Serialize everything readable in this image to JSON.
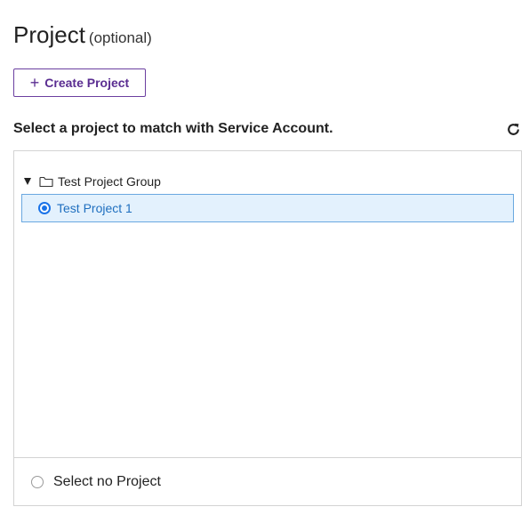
{
  "header": {
    "title": "Project",
    "optional_label": "(optional)"
  },
  "create_button": {
    "icon": "plus-icon",
    "label": "Create Project"
  },
  "instruction": "Select a project to match with Service Account.",
  "refresh": {
    "icon": "refresh-icon"
  },
  "tree": {
    "group": {
      "expanded": true,
      "icons": [
        "caret-down-icon",
        "folder-icon"
      ],
      "label": "Test Project Group"
    },
    "items": [
      {
        "label": "Test Project 1",
        "selected": true
      }
    ]
  },
  "no_project": {
    "label": "Select no Project",
    "selected": false
  },
  "colors": {
    "accent": "#5a2d91",
    "selection_background": "#e3f1fd",
    "selection_border": "#6aa8e0",
    "selection_text": "#1f6fbf",
    "radio_active": "#1a73e8"
  }
}
